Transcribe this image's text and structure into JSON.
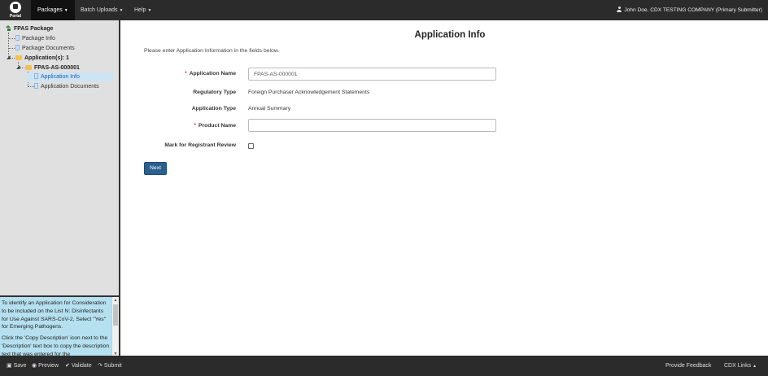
{
  "topbar": {
    "logo_text": "Portal",
    "nav": [
      {
        "label": "Packages"
      },
      {
        "label": "Batch Uploads"
      },
      {
        "label": "Help"
      }
    ],
    "user": "John Doe, CDX TESTING COMPANY (Primary Submitter)"
  },
  "sidebar": {
    "tree": {
      "root": "FPAS Package",
      "package_info": "Package Info",
      "package_documents": "Package Documents",
      "applications": "Application(s): 1",
      "application_id": "FPAS-AS-000001",
      "application_info": "Application Info",
      "application_documents": "Application Documents"
    },
    "help": {
      "paragraph1": "To identify an Application for Consideration to be included on the List N: Disinfectants for Use Against SARS-CoV-2, Select \"Yes\" for Emerging Pathogens.",
      "paragraph2": "Click the 'Copy Description' icon next to the 'Description' text box to copy the description text that was entered for the"
    }
  },
  "main": {
    "title": "Application Info",
    "intro": "Please enter Application Information in the fields below.",
    "application_name": {
      "label": "Application Name",
      "value": "FPAS-AS-000001"
    },
    "regulatory_type": {
      "label": "Regulatory Type",
      "value": "Foreign Purchaser Acknowledgement Statements"
    },
    "application_type": {
      "label": "Application Type",
      "value": "Annual Summary"
    },
    "product_name": {
      "label": "Product Name",
      "value": ""
    },
    "registrant_review": {
      "label": "Mark for Registrant Review",
      "checked": false
    },
    "next_label": "Next"
  },
  "bottombar": {
    "save": "Save",
    "preview": "Preview",
    "validate": "Validate",
    "submit": "Submit",
    "feedback": "Provide Feedback",
    "cdx_links": "CDX Links"
  }
}
